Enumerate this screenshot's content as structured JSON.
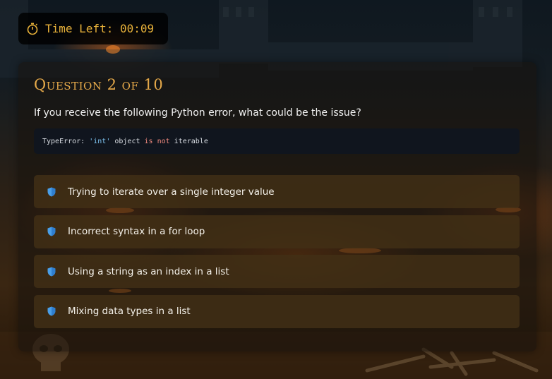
{
  "timer": {
    "icon": "stopwatch-icon",
    "label": "Time Left: 00:09"
  },
  "question": {
    "title": "Question 2 of 10",
    "text": "If you receive the following Python error, what could be the issue?"
  },
  "code": {
    "prefix": "TypeError: ",
    "string": "'int'",
    "middle": " object ",
    "keyword1": "is",
    "space": " ",
    "keyword2": "not",
    "suffix": " iterable"
  },
  "options": [
    {
      "icon": "shield-icon",
      "label": "Trying to iterate over a single integer value"
    },
    {
      "icon": "shield-icon",
      "label": "Incorrect syntax in a for loop"
    },
    {
      "icon": "shield-icon",
      "label": "Using a string as an index in a list"
    },
    {
      "icon": "shield-icon",
      "label": "Mixing data types in a list"
    }
  ],
  "colors": {
    "accent": "#e5a94a",
    "timer_text": "#e8b23a",
    "shield": "#4a9fe8"
  }
}
